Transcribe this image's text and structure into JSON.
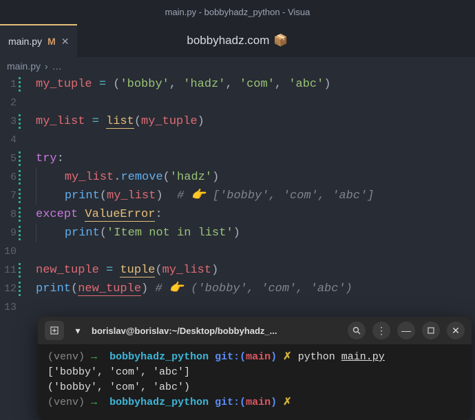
{
  "titlebar": "main.py - bobbyhadz_python - Visua",
  "tab": {
    "filename": "main.py",
    "modified_badge": "M",
    "close": "✕"
  },
  "watermark": {
    "text": "bobbyhadz.com",
    "icon": "📦"
  },
  "breadcrumb": {
    "file": "main.py",
    "sep": "›",
    "ellipsis": "…"
  },
  "gutter": [
    "1",
    "2",
    "3",
    "4",
    "5",
    "6",
    "7",
    "8",
    "9",
    "10",
    "11",
    "12",
    "13"
  ],
  "code": {
    "l1": {
      "var": "my_tuple",
      "op": "=",
      "p0": "(",
      "s0": "'bobby'",
      "c0": ", ",
      "s1": "'hadz'",
      "c1": ", ",
      "s2": "'com'",
      "c2": ", ",
      "s3": "'abc'",
      "p1": ")"
    },
    "l3": {
      "var": "my_list",
      "op": "=",
      "fn": "list",
      "p0": "(",
      "arg": "my_tuple",
      "p1": ")"
    },
    "l5": {
      "kw": "try",
      "colon": ":"
    },
    "l6": {
      "obj": "my_list",
      "dot": ".",
      "method": "remove",
      "p0": "(",
      "arg": "'hadz'",
      "p1": ")"
    },
    "l7": {
      "fn": "print",
      "p0": "(",
      "arg": "my_list",
      "p1": ")",
      "cmt": "# 👉️ ['bobby', 'com', 'abc']"
    },
    "l8": {
      "kw": "except",
      "err": "ValueError",
      "colon": ":"
    },
    "l9": {
      "fn": "print",
      "p0": "(",
      "arg": "'Item not in list'",
      "p1": ")"
    },
    "l11": {
      "var": "new_tuple",
      "op": "=",
      "fn": "tuple",
      "p0": "(",
      "arg": "my_list",
      "p1": ")"
    },
    "l12": {
      "fn": "print",
      "p0": "(",
      "arg": "new_tuple",
      "p1": ")",
      "cmt": "# 👉️ ('bobby', 'com', 'abc')"
    }
  },
  "terminal": {
    "title": "borislav@borislav:~/Desktop/bobbyhadz_...",
    "prompt": {
      "venv": "(venv)",
      "arrow": "→",
      "dir": "bobbyhadz_python",
      "git_lbl": "git:(",
      "branch": "main",
      "git_close": ")",
      "dirty": "✗"
    },
    "cmd": {
      "prog": "python",
      "arg": "main.py"
    },
    "out1": "['bobby', 'com', 'abc']",
    "out2": "('bobby', 'com', 'abc')"
  }
}
